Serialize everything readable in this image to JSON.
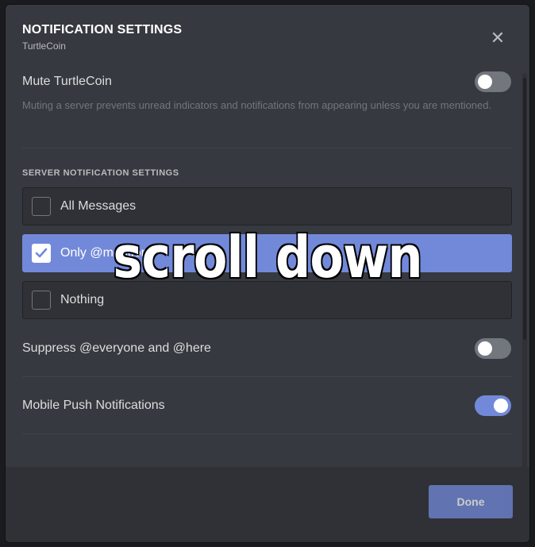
{
  "modal": {
    "title": "NOTIFICATION SETTINGS",
    "subtitle": "TurtleCoin",
    "close_icon": "close-icon"
  },
  "mute": {
    "label": "Mute TurtleCoin",
    "description": "Muting a server prevents unread indicators and notifications from appearing unless you are mentioned.",
    "enabled": false
  },
  "server_notifications": {
    "section_title": "SERVER NOTIFICATION SETTINGS",
    "options": [
      {
        "label": "All Messages",
        "selected": false
      },
      {
        "label": "Only @mentions",
        "selected": true
      },
      {
        "label": "Nothing",
        "selected": false
      }
    ]
  },
  "suppress": {
    "label": "Suppress @everyone and @here",
    "enabled": false
  },
  "mobile_push": {
    "label": "Mobile Push Notifications",
    "enabled": true
  },
  "footer": {
    "done_label": "Done"
  },
  "overlay": {
    "caption": "scroll down"
  },
  "colors": {
    "accent": "#7289da",
    "background": "#36393f",
    "footer": "#2f3136"
  }
}
